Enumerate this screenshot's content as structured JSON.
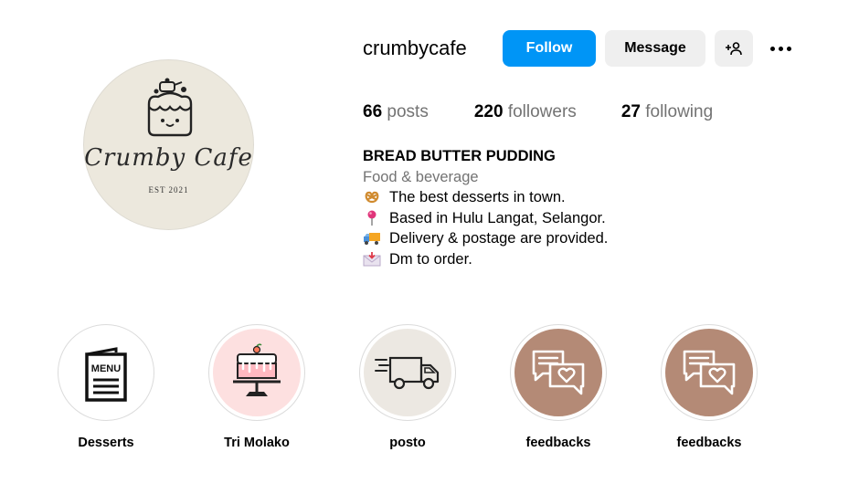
{
  "profile": {
    "username": "crumbycafe",
    "avatar": {
      "logo_text": "Crumby Cafe",
      "est_text": "EST 2021",
      "background": "#ece8dd"
    }
  },
  "actions": {
    "follow_label": "Follow",
    "message_label": "Message",
    "add_user_icon": "add-user-icon",
    "more_icon": "more-options-icon"
  },
  "stats": [
    {
      "value": "66",
      "label": "posts"
    },
    {
      "value": "220",
      "label": "followers"
    },
    {
      "value": "27",
      "label": "following"
    }
  ],
  "bio": {
    "name": "BREAD BUTTER PUDDING",
    "category": "Food & beverage",
    "lines": [
      {
        "icon": "pretzel-icon",
        "text": "The best desserts in town."
      },
      {
        "icon": "pin-icon",
        "text": "Based in Hulu Langat, Selangor."
      },
      {
        "icon": "truck-icon",
        "text": "Delivery & postage are provided."
      },
      {
        "icon": "envelope-icon",
        "text": "Dm to order."
      }
    ]
  },
  "highlights": [
    {
      "label": "Desserts",
      "icon": "menu-icon",
      "bg": "#ffffff"
    },
    {
      "label": "Tri Molako",
      "icon": "cake-stand-icon",
      "bg": "#fde0e0"
    },
    {
      "label": "posto",
      "icon": "delivery-truck-icon",
      "bg": "#ece8e2"
    },
    {
      "label": "feedbacks",
      "icon": "chat-heart-icon",
      "bg": "#b48a76"
    },
    {
      "label": "feedbacks",
      "icon": "chat-heart-icon",
      "bg": "#b48a76"
    }
  ],
  "colors": {
    "accent": "#0095f6",
    "secondary_button": "#efefef",
    "muted_text": "#737373"
  }
}
